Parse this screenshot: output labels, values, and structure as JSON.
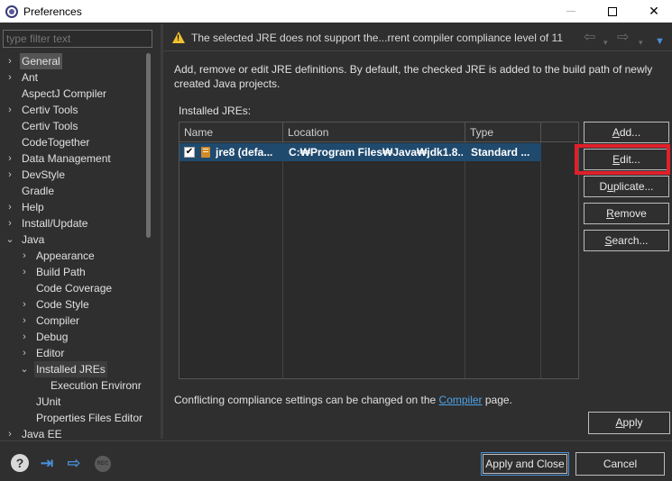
{
  "window": {
    "title": "Preferences",
    "minimize": "—",
    "maximize": "",
    "close": "✕"
  },
  "sidebar": {
    "filter_placeholder": "type filter text",
    "items": [
      {
        "label": "General",
        "chevron": "›",
        "indent": 0,
        "state": "selected"
      },
      {
        "label": "Ant",
        "chevron": "›",
        "indent": 0
      },
      {
        "label": "AspectJ Compiler",
        "chevron": "",
        "indent": 0
      },
      {
        "label": "Certiv Tools",
        "chevron": "›",
        "indent": 0
      },
      {
        "label": "Certiv Tools",
        "chevron": "",
        "indent": 0
      },
      {
        "label": "CodeTogether",
        "chevron": "",
        "indent": 0
      },
      {
        "label": "Data Management",
        "chevron": "›",
        "indent": 0
      },
      {
        "label": "DevStyle",
        "chevron": "›",
        "indent": 0
      },
      {
        "label": "Gradle",
        "chevron": "",
        "indent": 0
      },
      {
        "label": "Help",
        "chevron": "›",
        "indent": 0
      },
      {
        "label": "Install/Update",
        "chevron": "›",
        "indent": 0
      },
      {
        "label": "Java",
        "chevron": "⌄",
        "indent": 0
      },
      {
        "label": "Appearance",
        "chevron": "›",
        "indent": 1
      },
      {
        "label": "Build Path",
        "chevron": "›",
        "indent": 1
      },
      {
        "label": "Code Coverage",
        "chevron": "",
        "indent": 1
      },
      {
        "label": "Code Style",
        "chevron": "›",
        "indent": 1
      },
      {
        "label": "Compiler",
        "chevron": "›",
        "indent": 1
      },
      {
        "label": "Debug",
        "chevron": "›",
        "indent": 1
      },
      {
        "label": "Editor",
        "chevron": "›",
        "indent": 1
      },
      {
        "label": "Installed JREs",
        "chevron": "⌄",
        "indent": 1,
        "state": "current"
      },
      {
        "label": "Execution Environr",
        "chevron": "",
        "indent": 2
      },
      {
        "label": "JUnit",
        "chevron": "",
        "indent": 1
      },
      {
        "label": "Properties Files Editor",
        "chevron": "",
        "indent": 1
      },
      {
        "label": "Java EE",
        "chevron": "›",
        "indent": 0
      }
    ]
  },
  "header": {
    "warning": "The selected JRE does not support the...rrent compiler compliance level of 11",
    "nav_back": "⇦",
    "nav_back_dropdown": "▾",
    "nav_forward": "⇨",
    "nav_forward_dropdown": "▾",
    "view_menu": "▼"
  },
  "main": {
    "description": "Add, remove or edit JRE definitions. By default, the checked JRE is added to the build path of newly created Java projects.",
    "installed_label": "Installed JREs:",
    "table": {
      "columns": [
        "Name",
        "Location",
        "Type"
      ],
      "rows": [
        {
          "checked": "✔",
          "name": "jre8 (defa...",
          "location": "C:₩Program Files₩Java₩jdk1.8....",
          "type": "Standard ..."
        }
      ]
    },
    "buttons": {
      "add_prefix": "",
      "add_mnemonic": "A",
      "add_suffix": "dd...",
      "edit_prefix": "",
      "edit_mnemonic": "E",
      "edit_suffix": "dit...",
      "duplicate_prefix": "D",
      "duplicate_mnemonic": "u",
      "duplicate_suffix": "plicate...",
      "remove_prefix": "",
      "remove_mnemonic": "R",
      "remove_suffix": "emove",
      "search_prefix": "",
      "search_mnemonic": "S",
      "search_suffix": "earch..."
    },
    "conflict_text": "Conflicting compliance settings can be changed on the ",
    "conflict_link": "Compiler",
    "conflict_suffix": " page.",
    "apply_prefix": "",
    "apply_mnemonic": "A",
    "apply_suffix": "pply"
  },
  "footer": {
    "help_icon": "?",
    "import_icon": "⇥",
    "export_icon": "⇨",
    "rec_icon": "REC",
    "apply_close": "Apply and Close",
    "cancel": "Cancel"
  },
  "colors": {
    "highlight": "#e0202a",
    "selection_row": "#1f4a6e",
    "link": "#4da3e8",
    "warning": "#f0c030"
  }
}
